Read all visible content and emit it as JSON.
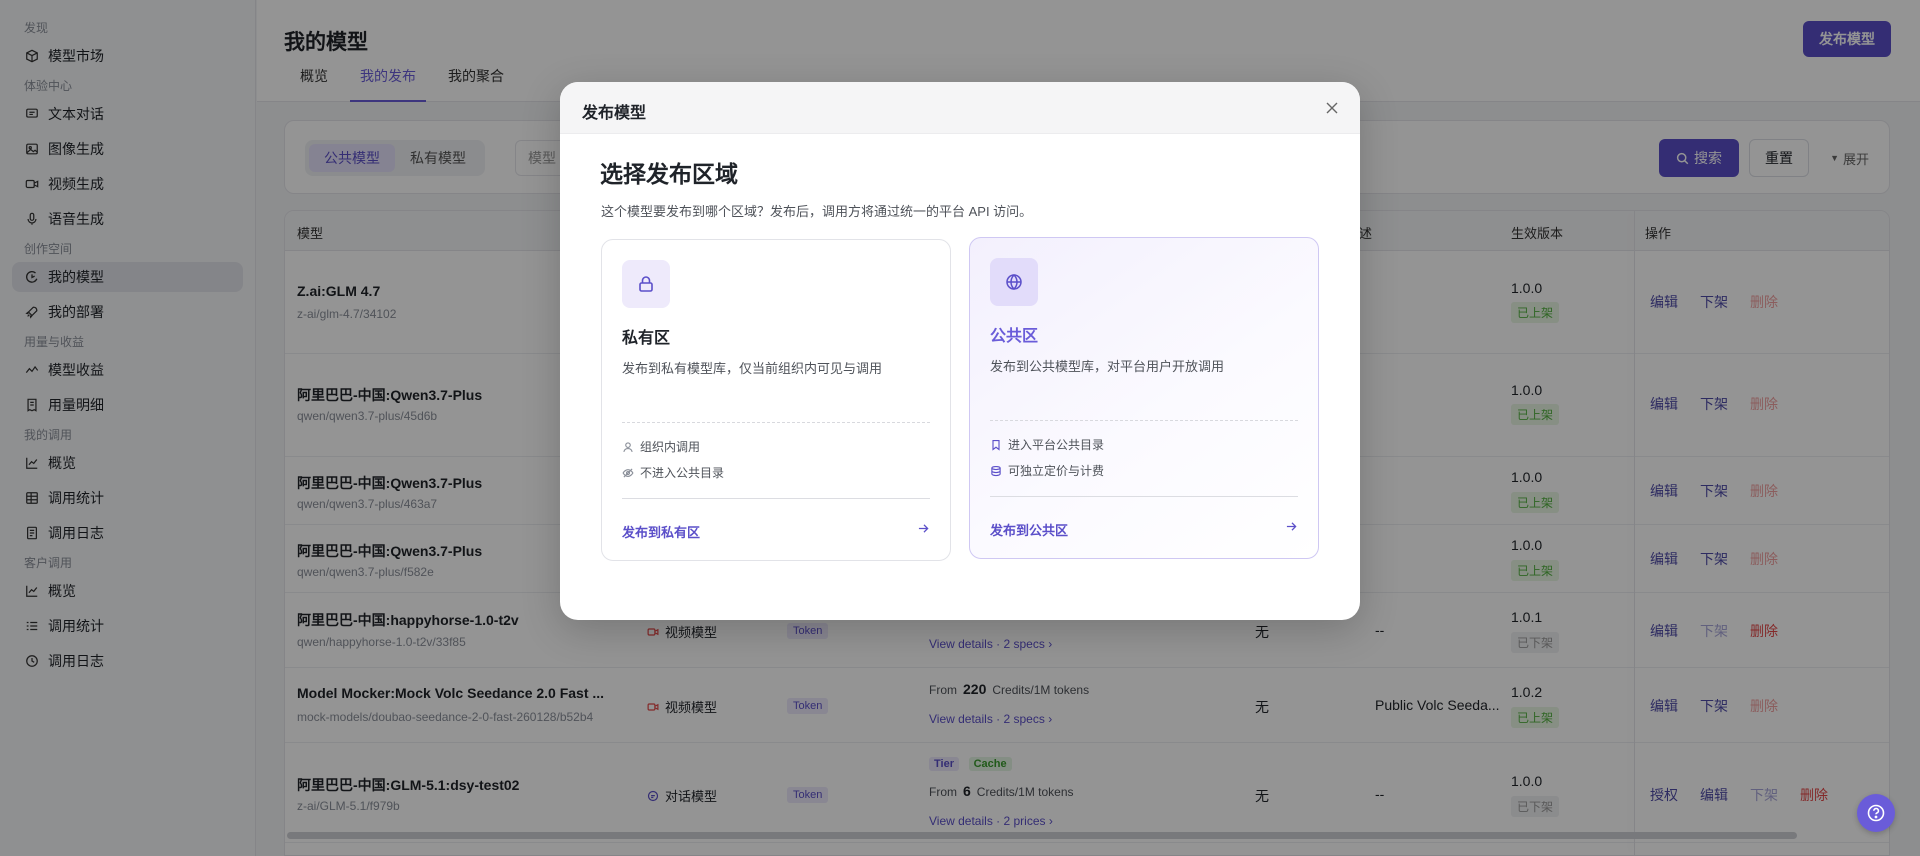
{
  "sidebar": {
    "groups": [
      {
        "label": "发现",
        "items": [
          {
            "label": "模型市场",
            "icon": "cube-icon"
          }
        ]
      },
      {
        "label": "体验中心",
        "items": [
          {
            "label": "文本对话",
            "icon": "chat-icon"
          },
          {
            "label": "图像生成",
            "icon": "image-icon"
          },
          {
            "label": "视频生成",
            "icon": "video-icon"
          },
          {
            "label": "语音生成",
            "icon": "mic-icon"
          }
        ]
      },
      {
        "label": "创作空间",
        "items": [
          {
            "label": "我的模型",
            "icon": "model-icon"
          },
          {
            "label": "我的部署",
            "icon": "rocket-icon"
          }
        ]
      },
      {
        "label": "用量与收益",
        "items": [
          {
            "label": "模型收益",
            "icon": "trend-icon"
          },
          {
            "label": "用量明细",
            "icon": "receipt-icon"
          }
        ]
      },
      {
        "label": "我的调用",
        "items": [
          {
            "label": "概览",
            "icon": "chart-icon"
          },
          {
            "label": "调用统计",
            "icon": "table-icon"
          },
          {
            "label": "调用日志",
            "icon": "log-icon"
          }
        ]
      },
      {
        "label": "客户调用",
        "items": [
          {
            "label": "概览",
            "icon": "chart-icon"
          },
          {
            "label": "调用统计",
            "icon": "list-icon"
          },
          {
            "label": "调用日志",
            "icon": "log-icon"
          }
        ]
      }
    ],
    "active": "我的模型"
  },
  "header": {
    "title": "我的模型",
    "publish_button": "发布模型",
    "tabs": [
      {
        "label": "概览"
      },
      {
        "label": "我的发布"
      },
      {
        "label": "我的聚合"
      }
    ],
    "active_tab": "我的发布"
  },
  "filters": {
    "segments": [
      "公共模型",
      "私有模型"
    ],
    "active_segment": "公共模型",
    "model_placeholder": "模型",
    "search_label": "搜索",
    "reset_label": "重置",
    "expand_label": "展开"
  },
  "table": {
    "headers": {
      "model": "模型",
      "desc": "述",
      "version": "生效版本",
      "ops": "操作"
    },
    "rows": [
      {
        "name": "Z.ai:GLM 4.7",
        "id": "z-ai/glm-4.7/34102",
        "version": "1.0.0",
        "status": "已上架",
        "ops": [
          "编辑",
          "下架",
          "删除"
        ]
      },
      {
        "name": "阿里巴巴-中国:Qwen3.7-Plus",
        "id": "qwen/qwen3.7-plus/45d6b",
        "version": "1.0.0",
        "status": "已上架",
        "ops": [
          "编辑",
          "下架",
          "删除"
        ]
      },
      {
        "name": "阿里巴巴-中国:Qwen3.7-Plus",
        "id": "qwen/qwen3.7-plus/463a7",
        "version": "1.0.0",
        "status": "已上架",
        "ops": [
          "编辑",
          "下架",
          "删除"
        ]
      },
      {
        "name": "阿里巴巴-中国:Qwen3.7-Plus",
        "id": "qwen/qwen3.7-plus/f582e",
        "version": "1.0.0",
        "status": "已上架",
        "ops": [
          "编辑",
          "下架",
          "删除"
        ]
      },
      {
        "name": "阿里巴巴-中国:happyhorse-1.0-t2v",
        "id": "qwen/happyhorse-1.0-t2v/33f85",
        "type": "视频模型",
        "billing": "Token",
        "details": "View details · 2 specs",
        "extra": "无",
        "desc": "--",
        "version": "1.0.1",
        "status": "已下架",
        "ops": [
          "编辑",
          "下架",
          "删除"
        ]
      },
      {
        "name": "Model Mocker:Mock Volc Seedance 2.0 Fast ...",
        "id": "mock-models/doubao-seedance-2-0-fast-260128/b52b4",
        "type": "视频模型",
        "billing": "Token",
        "price_from": "From",
        "price_value": "220",
        "price_unit": "Credits/1M tokens",
        "details": "View details · 2 specs",
        "extra": "无",
        "desc": "Public Volc Seeda...",
        "version": "1.0.2",
        "status": "已上架",
        "ops": [
          "编辑",
          "下架",
          "删除"
        ]
      },
      {
        "name": "阿里巴巴-中国:GLM-5.1:dsy-test02",
        "id": "z-ai/GLM-5.1/f979b",
        "type": "对话模型",
        "billing": "Token",
        "badges": [
          "Tier",
          "Cache"
        ],
        "price_from": "From",
        "price_value": "6",
        "price_unit": "Credits/1M tokens",
        "details": "View details · 2 prices",
        "extra": "无",
        "desc": "--",
        "version": "1.0.0",
        "status": "已下架",
        "ops": [
          "授权",
          "编辑",
          "下架",
          "删除"
        ]
      }
    ]
  },
  "modal": {
    "title": "发布模型",
    "heading": "选择发布区域",
    "description": "这个模型要发布到哪个区域？发布后，调用方将通过统一的平台 API 访问。",
    "private_zone": {
      "title": "私有区",
      "desc": "发布到私有模型库，仅当前组织内可见与调用",
      "features": [
        "组织内调用",
        "不进入公共目录"
      ],
      "cta": "发布到私有区"
    },
    "public_zone": {
      "title": "公共区",
      "desc": "发布到公共模型库，对平台用户开放调用",
      "features": [
        "进入平台公共目录",
        "可独立定价与计费"
      ],
      "cta": "发布到公共区"
    }
  },
  "colors": {
    "accent": "#5b4fc9",
    "success": "#52b03f",
    "danger": "#e34848"
  }
}
